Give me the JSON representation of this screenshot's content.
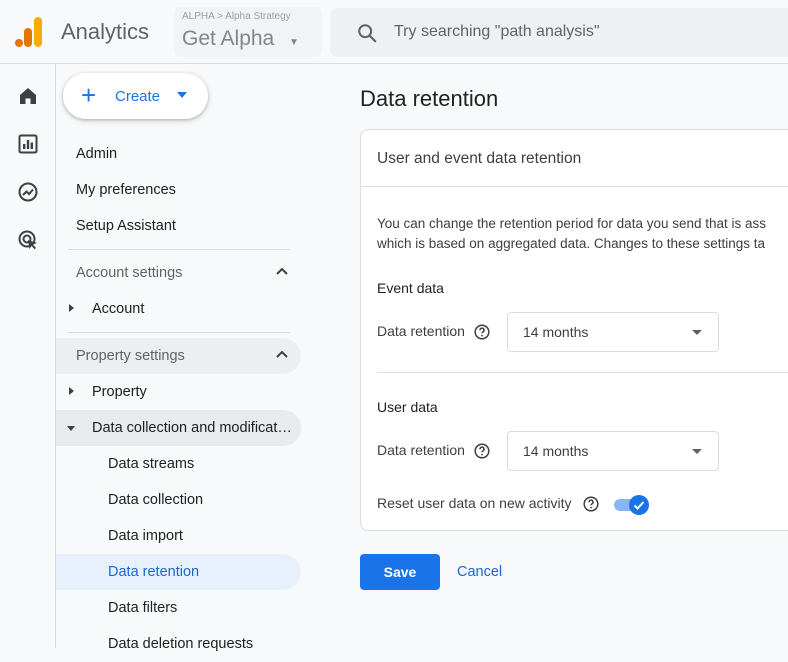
{
  "topbar": {
    "app_name": "Analytics",
    "property_crumb": "ALPHA > Alpha Strategy",
    "property_name": "Get Alpha",
    "search_placeholder": "Try searching \"path analysis\""
  },
  "rail": {
    "icons": [
      "home-icon",
      "reports-icon",
      "explore-icon",
      "advertising-icon"
    ]
  },
  "nav": {
    "create_label": "Create",
    "top_items": [
      "Admin",
      "My preferences",
      "Setup Assistant"
    ],
    "account_settings": {
      "title": "Account settings",
      "items": [
        "Account"
      ]
    },
    "property_settings": {
      "title": "Property settings",
      "property": "Property",
      "data_collection": "Data collection and modifications",
      "sub_items": [
        "Data streams",
        "Data collection",
        "Data import",
        "Data retention",
        "Data filters",
        "Data deletion requests"
      ],
      "active": "Data retention"
    }
  },
  "main": {
    "page_title": "Data retention",
    "card": {
      "title": "User and event data retention",
      "description_line1": "You can change the retention period for data you send that is ass",
      "description_line2": "which is based on aggregated data. Changes to these settings ta",
      "event_section": "Event data",
      "event_retention_label": "Data retention",
      "event_retention_value": "14 months",
      "user_section": "User data",
      "user_retention_label": "Data retention",
      "user_retention_value": "14 months",
      "reset_label": "Reset user data on new activity",
      "reset_enabled": true
    },
    "save_label": "Save",
    "cancel_label": "Cancel"
  },
  "colors": {
    "accent": "#1a73e8",
    "logo_orange": "#f9ab00",
    "logo_dark_orange": "#e37400"
  }
}
